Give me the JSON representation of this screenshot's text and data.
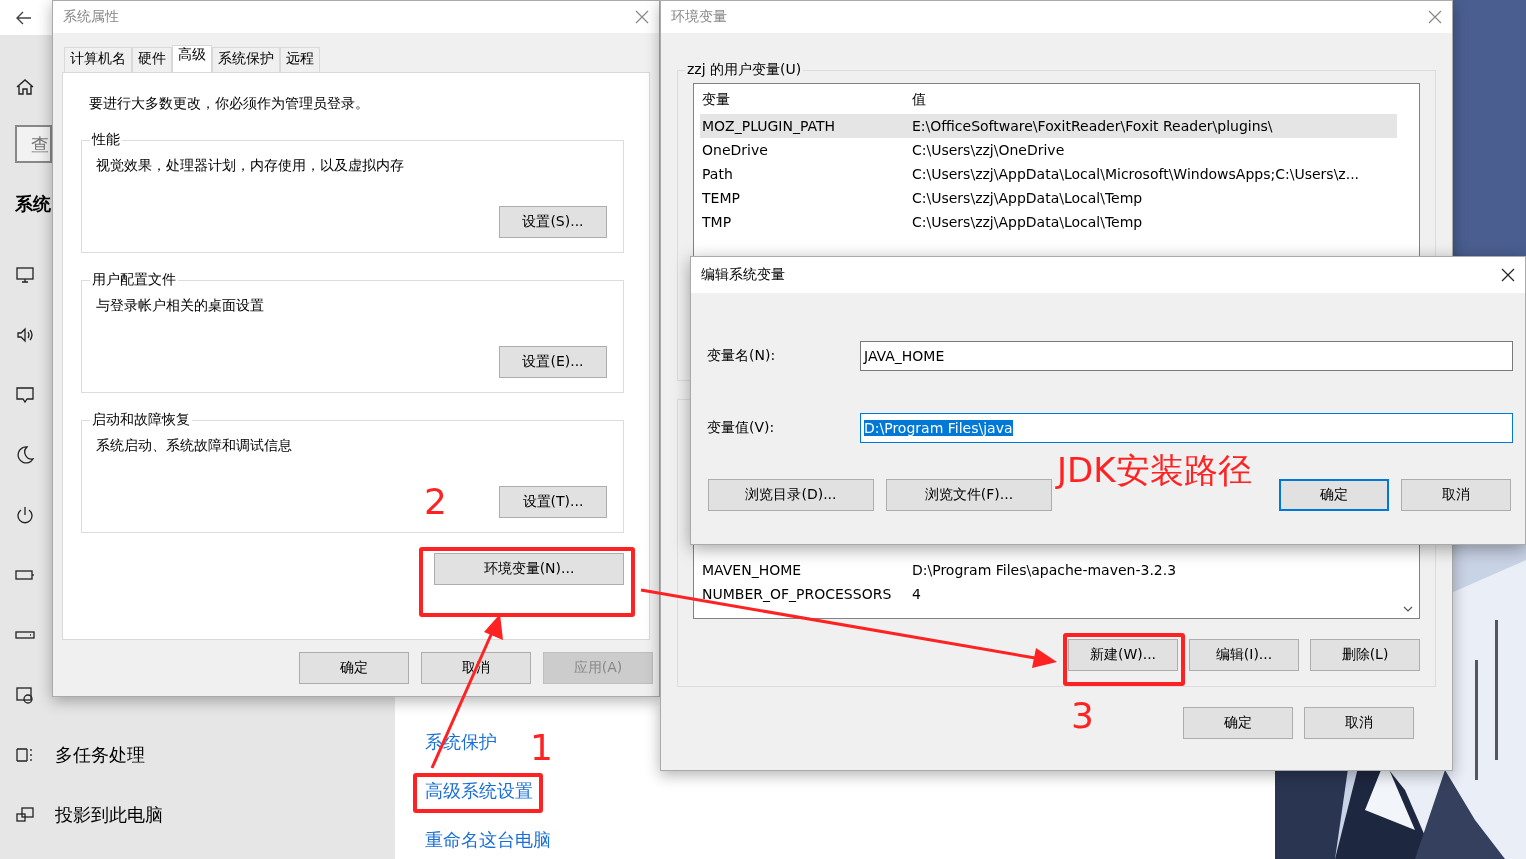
{
  "settings": {
    "search_placeholder": "查",
    "header": "系统",
    "nav_items": [
      {
        "label": "多任务处理"
      },
      {
        "label": "投影到此电脑"
      }
    ],
    "links": [
      "系统保护",
      "高级系统设置",
      "重命名这台电脑"
    ]
  },
  "system_properties": {
    "title": "系统属性",
    "tabs": [
      {
        "label": "计算机名",
        "selected": false
      },
      {
        "label": "硬件",
        "selected": false
      },
      {
        "label": "高级",
        "selected": true
      },
      {
        "label": "系统保护",
        "selected": false
      },
      {
        "label": "远程",
        "selected": false
      }
    ],
    "admin_note": "要进行大多数更改，你必须作为管理员登录。",
    "groups": [
      {
        "title": "性能",
        "description": "视觉效果，处理器计划，内存使用，以及虚拟内存",
        "button": "设置(S)..."
      },
      {
        "title": "用户配置文件",
        "description": "与登录帐户相关的桌面设置",
        "button": "设置(E)..."
      },
      {
        "title": "启动和故障恢复",
        "description": "系统启动、系统故障和调试信息",
        "button": "设置(T)..."
      }
    ],
    "env_button": "环境变量(N)...",
    "buttons": [
      {
        "label": "确定",
        "disabled": false
      },
      {
        "label": "取消",
        "disabled": false
      },
      {
        "label": "应用(A)",
        "disabled": true
      }
    ]
  },
  "env_vars": {
    "title": "环境变量",
    "user_group_title": "zzj 的用户变量(U)",
    "columns": [
      "变量",
      "值"
    ],
    "user_rows": [
      {
        "name": "MOZ_PLUGIN_PATH",
        "value": "E:\\OfficeSoftware\\FoxitReader\\Foxit Reader\\plugins\\",
        "selected": true
      },
      {
        "name": "OneDrive",
        "value": "C:\\Users\\zzj\\OneDrive",
        "selected": false
      },
      {
        "name": "Path",
        "value": "C:\\Users\\zzj\\AppData\\Local\\Microsoft\\WindowsApps;C:\\Users\\z...",
        "selected": false
      },
      {
        "name": "TEMP",
        "value": "C:\\Users\\zzj\\AppData\\Local\\Temp",
        "selected": false
      },
      {
        "name": "TMP",
        "value": "C:\\Users\\zzj\\AppData\\Local\\Temp",
        "selected": false
      }
    ],
    "system_rows": [
      {
        "name": "MAVEN_HOME",
        "value": "D:\\Program Files\\apache-maven-3.2.3"
      },
      {
        "name": "NUMBER_OF_PROCESSORS",
        "value": "4"
      }
    ],
    "system_buttons": [
      "新建(W)...",
      "编辑(I)...",
      "删除(L)"
    ],
    "buttons": [
      "确定",
      "取消"
    ]
  },
  "edit_dialog": {
    "title": "编辑系统变量",
    "fields": [
      {
        "label": "变量名(N):",
        "value": "JAVA_HOME",
        "selected": false
      },
      {
        "label": "变量值(V):",
        "value": "D:\\Program Files\\java",
        "selected": true
      }
    ],
    "left_buttons": [
      "浏览目录(D)...",
      "浏览文件(F)..."
    ],
    "buttons": [
      {
        "label": "确定",
        "default": true
      },
      {
        "label": "取消",
        "default": false
      }
    ]
  },
  "annotations": {
    "step_labels": [
      "2",
      "1",
      "3"
    ],
    "note": "JDK安装路径"
  }
}
